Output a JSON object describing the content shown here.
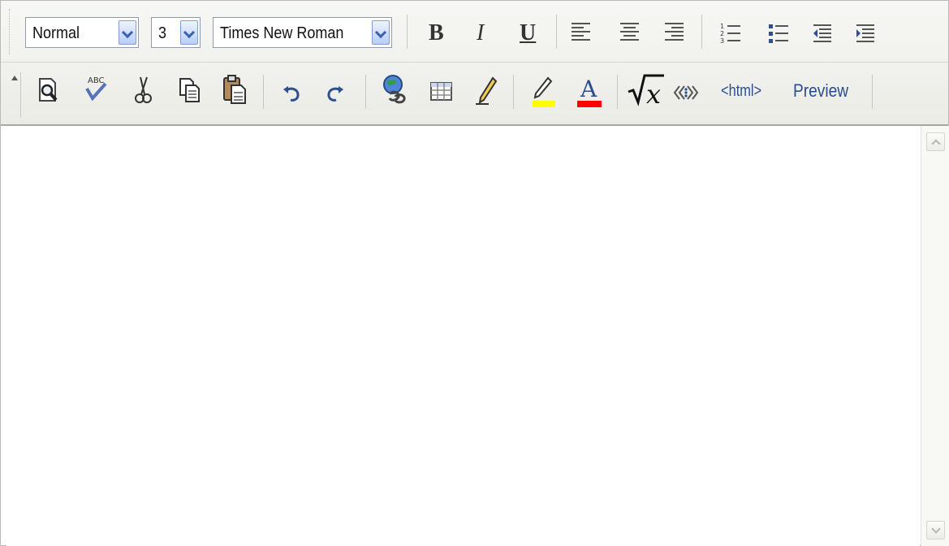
{
  "toolbar": {
    "format_select": {
      "value": "Normal"
    },
    "size_select": {
      "value": "3"
    },
    "font_select": {
      "value": "Times New Roman"
    },
    "bold_label": "B",
    "italic_label": "I",
    "underline_label": "U",
    "html_label": "<html>",
    "preview_label": "Preview",
    "icons": {
      "preview": "print-preview-icon",
      "spell": "spell-check-icon",
      "cut": "cut-icon",
      "copy": "copy-icon",
      "paste": "paste-icon",
      "undo": "undo-icon",
      "redo": "redo-icon",
      "link": "globe-link-icon",
      "table": "table-icon",
      "pencil": "pencil-icon",
      "highlight": "highlight-icon",
      "font_color": "font-color-icon",
      "formula": "formula-icon",
      "code": "code-icon"
    }
  },
  "colors": {
    "highlight": "#ffff00",
    "font_color": "#ff0000",
    "select_border": "#8c9db3"
  }
}
